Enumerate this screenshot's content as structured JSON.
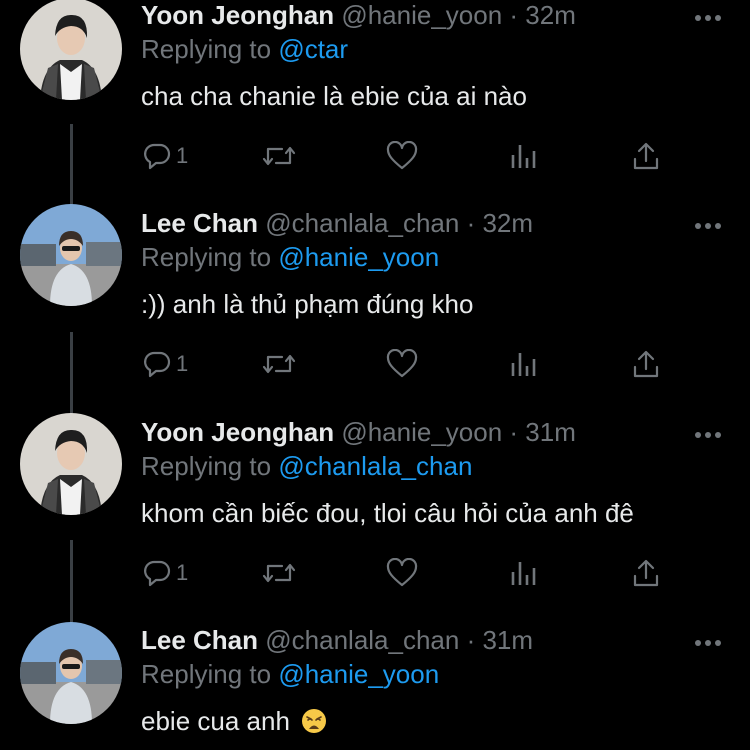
{
  "thread": [
    {
      "name": "Yoon Jeonghan",
      "handle": "@hanie_yoon",
      "dot": " · ",
      "time": "32m",
      "replying_prefix": "Replying to ",
      "replying_to": "@ctar",
      "text": "cha cha chanie là ebie của ai nào",
      "emoji": "",
      "reply_count": "1",
      "avatar": "yoon"
    },
    {
      "name": "Lee Chan",
      "handle": "@chanlala_chan",
      "dot": " · ",
      "time": "32m",
      "replying_prefix": "Replying to ",
      "replying_to": "@hanie_yoon",
      "text": ":)) anh là thủ phạm đúng kho",
      "emoji": "",
      "reply_count": "1",
      "avatar": "lee"
    },
    {
      "name": "Yoon Jeonghan",
      "handle": "@hanie_yoon",
      "dot": " · ",
      "time": "31m",
      "replying_prefix": "Replying to ",
      "replying_to": "@chanlala_chan",
      "text": "khom cần biếc đou, tloi câu hỏi của anh đê",
      "emoji": "",
      "reply_count": "1",
      "avatar": "yoon"
    },
    {
      "name": "Lee Chan",
      "handle": "@chanlala_chan",
      "dot": " · ",
      "time": "31m",
      "replying_prefix": "Replying to ",
      "replying_to": "@hanie_yoon",
      "text": "ebie cua anh",
      "emoji": "weary-face",
      "reply_count": "",
      "avatar": "lee"
    }
  ],
  "icons": {
    "reply": "reply-icon",
    "retweet": "retweet-icon",
    "like": "heart-icon",
    "views": "views-icon",
    "share": "share-icon",
    "more": "more-icon"
  },
  "colors": {
    "background": "#000000",
    "text": "#e7e9ea",
    "muted": "#71767b",
    "accent": "#1d9bf0",
    "thread_line": "#3a3f44"
  }
}
